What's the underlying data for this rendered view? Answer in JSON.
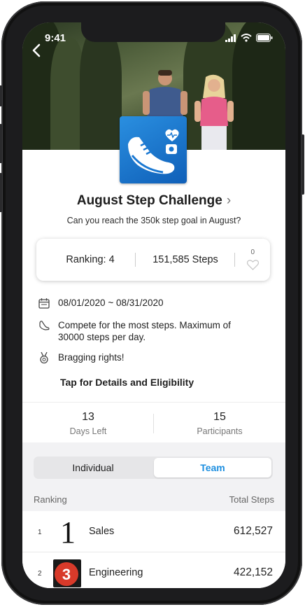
{
  "status_bar": {
    "time": "9:41"
  },
  "nav": {
    "back_glyph": "‹"
  },
  "challenge": {
    "title": "August Step Challenge",
    "title_chevron": "›",
    "subtitle": "Can you reach the 350k step goal in August?",
    "icon": "shoe-health-app-icon"
  },
  "stats": {
    "ranking": "Ranking: 4",
    "steps": "151,585 Steps",
    "likes": "0"
  },
  "info": {
    "dates": "08/01/2020 ~ 08/31/2020",
    "rule_line1": "Compete for the most steps. Maximum of",
    "rule_line2": "30000 steps per day.",
    "reward": "Bragging rights!",
    "details_link": "Tap for Details and Eligibility"
  },
  "counts": {
    "days_left_value": "13",
    "days_left_label": "Days Left",
    "participants_value": "15",
    "participants_label": "Participants"
  },
  "segments": {
    "individual": "Individual",
    "team": "Team",
    "selected": "Team"
  },
  "table": {
    "col_ranking": "Ranking",
    "col_total": "Total Steps",
    "rows": [
      {
        "rank": "1",
        "badge_text": "1",
        "name": "Sales",
        "steps": "612,527"
      },
      {
        "rank": "2",
        "badge_text": "3",
        "name": "Engineering",
        "steps": "422,152"
      }
    ]
  },
  "colors": {
    "accent_blue": "#1e8fe0",
    "app_icon_blue": "#1a78d2",
    "badge_red": "#d83a2a"
  }
}
